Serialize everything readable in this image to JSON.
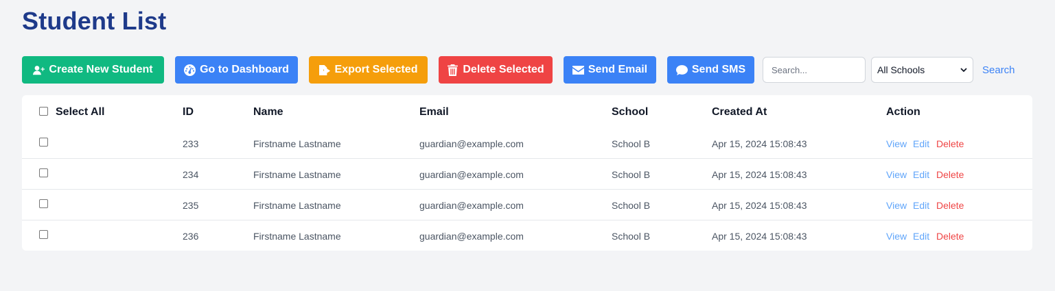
{
  "page": {
    "title": "Student List"
  },
  "toolbar": {
    "create_label": "Create New Student",
    "dashboard_label": "Go to Dashboard",
    "export_label": "Export Selected",
    "delete_label": "Delete Selected",
    "email_label": "Send Email",
    "sms_label": "Send SMS",
    "search_placeholder": "Search...",
    "school_filter_value": "All Schools",
    "search_link_label": "Search"
  },
  "colors": {
    "create": "#10b981",
    "primary": "#3b82f6",
    "export": "#f59e0b",
    "danger": "#ef4444",
    "title": "#1e3a8a"
  },
  "table": {
    "headers": {
      "select_all": "Select All",
      "id": "ID",
      "name": "Name",
      "email": "Email",
      "school": "School",
      "created": "Created At",
      "action": "Action"
    },
    "rows": [
      {
        "id": "233",
        "name": "Firstname Lastname",
        "email": "guardian@example.com",
        "school": "School B",
        "created": "Apr 15, 2024 15:08:43"
      },
      {
        "id": "234",
        "name": "Firstname Lastname",
        "email": "guardian@example.com",
        "school": "School B",
        "created": "Apr 15, 2024 15:08:43"
      },
      {
        "id": "235",
        "name": "Firstname Lastname",
        "email": "guardian@example.com",
        "school": "School B",
        "created": "Apr 15, 2024 15:08:43"
      },
      {
        "id": "236",
        "name": "Firstname Lastname",
        "email": "guardian@example.com",
        "school": "School B",
        "created": "Apr 15, 2024 15:08:43"
      }
    ],
    "actions": {
      "view": "View",
      "edit": "Edit",
      "delete": "Delete"
    }
  }
}
